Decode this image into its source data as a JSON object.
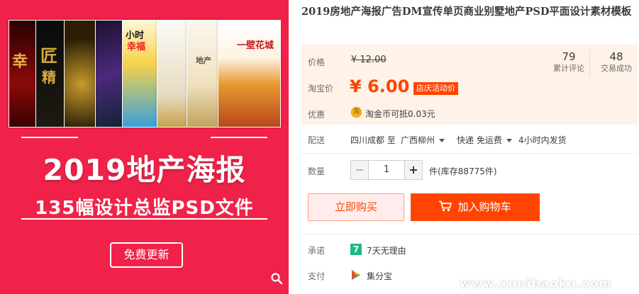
{
  "product_image": {
    "headline": "2019地产海报",
    "subline": "135幅设计总监PSD文件",
    "free_update_label": "免费更新",
    "zoom_icon": "magnifier-icon"
  },
  "title": "2019房地产海报广告DM宣传单页商业别墅地产PSD平面设计素材模板",
  "price": {
    "price_label": "价格",
    "original_price": "¥ 12.00",
    "taobao_price_label": "淘宝价",
    "taobao_price": "¥ 6.00",
    "promo_tag": "店庆活动价",
    "stats": [
      {
        "value": "79",
        "label": "累计评论"
      },
      {
        "value": "48",
        "label": "交易成功"
      }
    ],
    "offer_label": "优惠",
    "coin_glyph": "淘",
    "coin_text": "淘金币可抵0.03元"
  },
  "shipping": {
    "label": "配送",
    "from": "四川成都 至",
    "to": "广西柳州",
    "method": "快递 免运费",
    "ship_time": "4小时内发货"
  },
  "quantity": {
    "label": "数量",
    "minus": "−",
    "value": "1",
    "plus": "+",
    "stock": "件(库存88775件)"
  },
  "actions": {
    "buy_now": "立即购买",
    "add_to_cart": "加入购物车"
  },
  "promise": {
    "label": "承诺",
    "badge": "7",
    "text": "7天无理由"
  },
  "payment": {
    "label": "支付",
    "text": "集分宝"
  },
  "watermark": "www.xunibaoku.com",
  "colors": {
    "accent": "#ff4400",
    "image_bg": "#f1224a",
    "price_panel_bg": "#fff2e8"
  }
}
